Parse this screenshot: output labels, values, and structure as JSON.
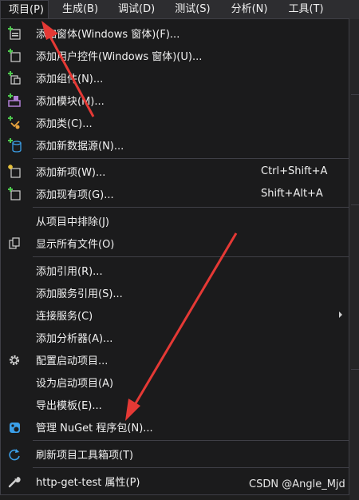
{
  "menubar": [
    {
      "label": "项目(P)"
    },
    {
      "label": "生成(B)"
    },
    {
      "label": "调试(D)"
    },
    {
      "label": "测试(S)"
    },
    {
      "label": "分析(N)"
    },
    {
      "label": "工具(T)"
    }
  ],
  "menu": {
    "items": [
      {
        "label": "添加窗体(Windows 窗体)(F)...",
        "shortcut": "",
        "icon": "add-form-icon"
      },
      {
        "label": "添加用户控件(Windows 窗体)(U)...",
        "shortcut": "",
        "icon": "add-user-control-icon"
      },
      {
        "label": "添加组件(N)...",
        "shortcut": "",
        "icon": "add-component-icon"
      },
      {
        "label": "添加模块(M)...",
        "shortcut": "",
        "icon": "add-module-icon"
      },
      {
        "label": "添加类(C)...",
        "shortcut": "",
        "icon": "add-class-icon"
      },
      {
        "label": "添加新数据源(N)...",
        "shortcut": "",
        "icon": "add-data-source-icon"
      },
      {
        "label": "添加新项(W)...",
        "shortcut": "Ctrl+Shift+A",
        "icon": "add-new-item-icon"
      },
      {
        "label": "添加现有项(G)...",
        "shortcut": "Shift+Alt+A",
        "icon": "add-existing-item-icon"
      },
      {
        "label": "从项目中排除(J)",
        "shortcut": ""
      },
      {
        "label": "显示所有文件(O)",
        "shortcut": "",
        "icon": "show-all-files-icon"
      },
      {
        "label": "添加引用(R)...",
        "shortcut": ""
      },
      {
        "label": "添加服务引用(S)...",
        "shortcut": ""
      },
      {
        "label": "连接服务(C)",
        "shortcut": ""
      },
      {
        "label": "添加分析器(A)...",
        "shortcut": ""
      },
      {
        "label": "配置启动项目...",
        "shortcut": "",
        "icon": "gear-icon"
      },
      {
        "label": "设为启动项目(A)",
        "shortcut": ""
      },
      {
        "label": "导出模板(E)...",
        "shortcut": ""
      },
      {
        "label": "管理 NuGet 程序包(N)...",
        "shortcut": "",
        "icon": "nuget-icon"
      },
      {
        "label": "刷新项目工具箱项(T)",
        "shortcut": "",
        "icon": "refresh-icon"
      },
      {
        "label": "http-get-test 属性(P)",
        "shortcut": "",
        "icon": "wrench-icon"
      }
    ]
  },
  "colors": {
    "menu_bg": "#1b1b1c",
    "menubar_bg": "#2d2d30",
    "separator": "#3f3f46",
    "annotation": "#e53935",
    "icon_green": "#4ec94e",
    "icon_purple": "#b180d7",
    "icon_blue": "#3b9fe8"
  },
  "watermark": "CSDN @Angle_Mjd"
}
